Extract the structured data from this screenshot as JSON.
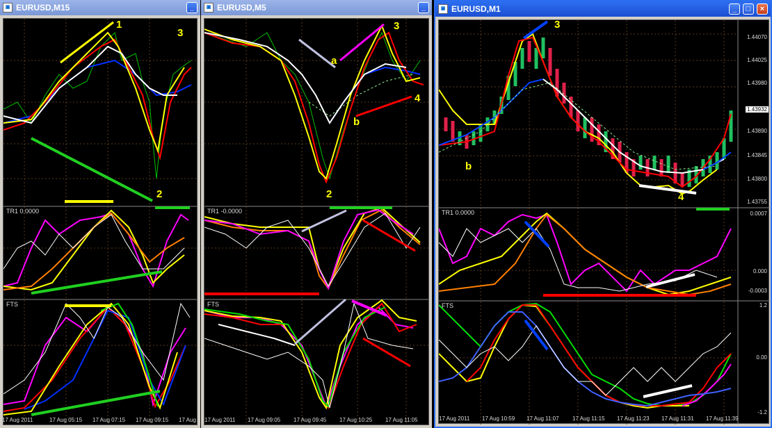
{
  "windows": [
    {
      "title": "EURUSD,M15",
      "x_labels": [
        "17 Aug 2011",
        "17 Aug 05:15",
        "17 Aug 07:15",
        "17 Aug 09:15",
        "17 Aug"
      ],
      "annotations": [
        "1",
        "3",
        "2"
      ]
    },
    {
      "title": "EURUSD,M5",
      "x_labels": [
        "17 Aug 2011",
        "17 Aug 09:05",
        "17 Aug 09:45",
        "17 Aug 10:25",
        "17 Aug 11:05"
      ],
      "annotations": [
        "3",
        "a",
        "4",
        "b",
        "2"
      ]
    },
    {
      "title": "EURUSD,M1",
      "x_labels": [
        "17 Aug 2011",
        "17 Aug 10:59",
        "17 Aug 11:07",
        "17 Aug 11:15",
        "17 Aug 11:23",
        "17 Aug 11:31",
        "17 Aug 11:39"
      ],
      "annotations": [
        "3",
        "b",
        "4"
      ],
      "price_axis": [
        "1.44070",
        "1.44025",
        "1.43980",
        "1.43932",
        "1.43890",
        "1.43845",
        "1.43800",
        "1.43755"
      ],
      "tr1_axis": [
        "0.0007",
        "0.000",
        "-0.0003"
      ],
      "fts_axis": [
        "1.2",
        "0.00",
        "-1.2"
      ]
    }
  ],
  "indicators": {
    "tr1_left": "TR1 0.0000",
    "tr1_mid": "TR1 -0.0000",
    "tr1_right": "TR1 0.0000",
    "fts": "FTS"
  },
  "buttons": {
    "minimize": "_",
    "maximize": "□",
    "close": "×"
  },
  "colors": {
    "price_red": "#ff0000",
    "price_yellow": "#ffff00",
    "price_white": "#ffffff",
    "price_blue": "#0040ff",
    "price_green": "#00c000",
    "magenta": "#ff00ff",
    "grid": "#5a3a1a"
  }
}
